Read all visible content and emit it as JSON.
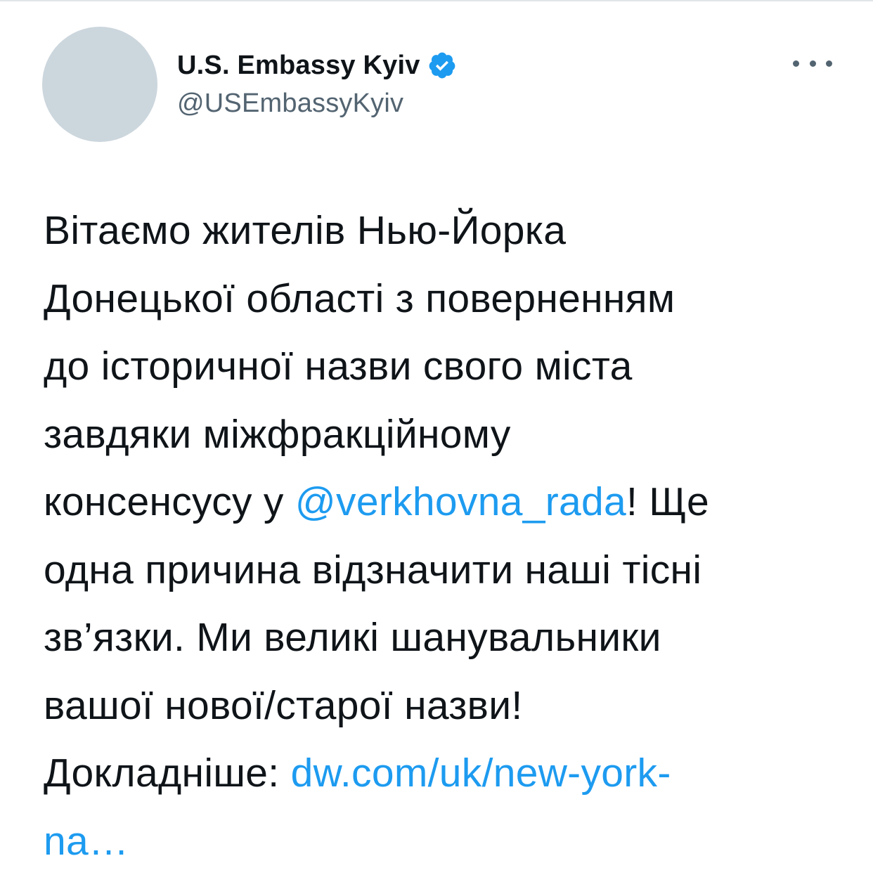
{
  "tweet": {
    "author": {
      "display_name": "U.S. Embassy Kyiv",
      "handle": "@USEmbassyKyiv",
      "verified": true,
      "verified_icon": "verified-badge-icon",
      "avatar_color": "#ccd6dd"
    },
    "more_icon": "more-horizontal-icon",
    "text_lines": [
      {
        "parts": [
          {
            "text": "Вітаємо жителів Нью-Йорка"
          }
        ]
      },
      {
        "parts": [
          {
            "text": "Донецької області з поверненням"
          }
        ]
      },
      {
        "parts": [
          {
            "text": "до історичної назви свого міста"
          }
        ]
      },
      {
        "parts": [
          {
            "text": "завдяки міжфракційному"
          }
        ]
      },
      {
        "parts": [
          {
            "text": "консенсусу у "
          },
          {
            "text": "@verkhovna_rada",
            "link": true
          },
          {
            "text": "! Ще"
          }
        ]
      },
      {
        "parts": [
          {
            "text": "одна причина відзначити наші тісні"
          }
        ]
      },
      {
        "parts": [
          {
            "text": "зв’язки. Ми великі шанувальники"
          }
        ]
      },
      {
        "parts": [
          {
            "text": "вашої нової/старої назви!"
          }
        ]
      },
      {
        "parts": [
          {
            "text": "Докладніше: "
          },
          {
            "text": "dw.com/uk/new-york-",
            "link": true
          }
        ]
      },
      {
        "parts": [
          {
            "text": "na…",
            "link": true
          }
        ]
      }
    ],
    "colors": {
      "text": "#0f1419",
      "secondary": "#536471",
      "link": "#1d9bf0",
      "verified": "#1d9bf0"
    }
  }
}
